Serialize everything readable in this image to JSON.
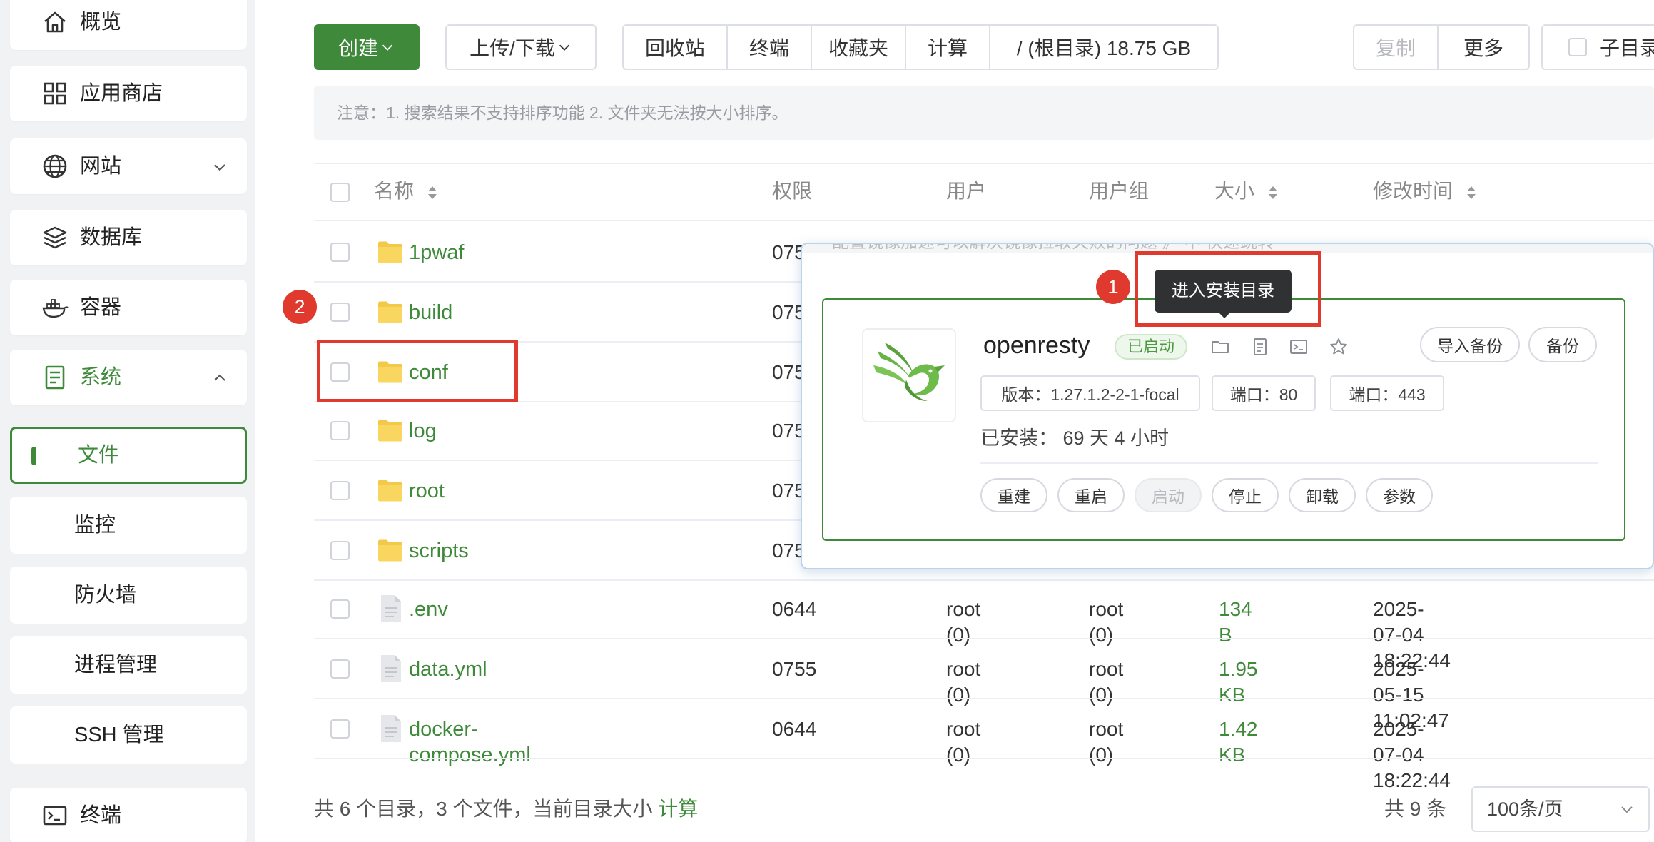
{
  "sidebar": {
    "items": [
      {
        "label": "概览",
        "icon": "home-icon"
      },
      {
        "label": "应用商店",
        "icon": "apps-grid-icon"
      },
      {
        "label": "网站",
        "icon": "globe-icon"
      },
      {
        "label": "数据库",
        "icon": "database-layers-icon"
      },
      {
        "label": "容器",
        "icon": "docker-whale-icon"
      },
      {
        "label": "系统",
        "icon": "system-document-icon"
      }
    ],
    "sub_items": [
      {
        "label": "文件"
      },
      {
        "label": "监控"
      },
      {
        "label": "防火墙"
      },
      {
        "label": "进程管理"
      },
      {
        "label": "SSH 管理"
      }
    ],
    "terminal": {
      "label": "终端",
      "icon": "terminal-icon"
    }
  },
  "toolbar": {
    "create_label": "创建",
    "upload_label": "上传/下载",
    "recycle_label": "回收站",
    "terminal_label": "终端",
    "favorites_label": "收藏夹",
    "calc_label": "计算",
    "path_label": "/ (根目录) 18.75 GB",
    "copy_label": "复制",
    "more_label": "更多",
    "subdir_label": "子目录"
  },
  "notice": "注意：1. 搜索结果不支持排序功能 2. 文件夹无法按大小排序。",
  "table": {
    "headers": {
      "name": "名称",
      "perm": "权限",
      "user": "用户",
      "group": "用户组",
      "size": "大小",
      "mtime": "修改时间"
    },
    "rows": [
      {
        "name": "1pwaf",
        "type": "folder",
        "perm": "075"
      },
      {
        "name": "build",
        "type": "folder",
        "perm": "075"
      },
      {
        "name": "conf",
        "type": "folder",
        "perm": "075"
      },
      {
        "name": "log",
        "type": "folder",
        "perm": "075"
      },
      {
        "name": "root",
        "type": "folder",
        "perm": "075"
      },
      {
        "name": "scripts",
        "type": "folder",
        "perm": "075"
      },
      {
        "name": ".env",
        "type": "file",
        "perm": "0644",
        "user": "root (0)",
        "group": "root (0)",
        "size": "134 B",
        "mtime": "2025-07-04 18:22:44"
      },
      {
        "name": "data.yml",
        "type": "file",
        "perm": "0755",
        "user": "root (0)",
        "group": "root (0)",
        "size": "1.95 KB",
        "mtime": "2025-05-15 11:02:47"
      },
      {
        "name": "docker-compose.yml",
        "type": "file",
        "perm": "0644",
        "user": "root (0)",
        "group": "root (0)",
        "size": "1.42 KB",
        "mtime": "2025-07-04 18:22:44"
      }
    ]
  },
  "footer": {
    "summary": "共 6 个目录，3 个文件，当前目录大小 ",
    "calc_link": "计算",
    "total": "共 9 条",
    "page_size": "100条/页"
  },
  "popover": {
    "top_text": "配置镜像加速可以解决镜像拉取失败的问题   》 中 快速跳转",
    "app_name": "openresty",
    "status": "已启动",
    "import_backup": "导入备份",
    "backup": "备份",
    "version": "版本：1.27.1.2-2-1-focal",
    "port1": "端口：80",
    "port2": "端口：443",
    "installed": "已安装：  69 天 4 小时",
    "actions": [
      "重建",
      "重启",
      "启动",
      "停止",
      "卸载",
      "参数"
    ],
    "header_icons": [
      "folder-open-icon",
      "log-document-icon",
      "terminal-icon",
      "star-icon"
    ]
  },
  "annotations": {
    "tooltip": "进入安装目录",
    "badge1": "1",
    "badge2": "2"
  },
  "colors": {
    "accent": "#3f8a3a",
    "annotation": "#e03a2f"
  }
}
